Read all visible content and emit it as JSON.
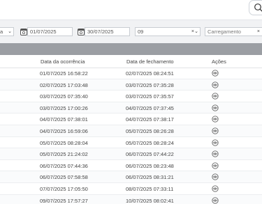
{
  "filters": {
    "status_fragment": "a",
    "date_start": "01/07/2025",
    "date_end": "30/07/2025",
    "code_value": "09",
    "state_placeholder": "Carregamento"
  },
  "table": {
    "headers": {
      "occurrence": "Data da ocorrência",
      "closing": "Data de fechamento",
      "actions": "Ações"
    },
    "rows": [
      {
        "occurrence": "01/07/2025 16:58:22",
        "closing": "02/07/2025 08:24:51"
      },
      {
        "occurrence": "02/07/2025 17:03:48",
        "closing": "03/07/2025 07:35:28"
      },
      {
        "occurrence": "03/07/2025 07:35:40",
        "closing": "03/07/2025 07:35:57"
      },
      {
        "occurrence": "03/07/2025 17:00:26",
        "closing": "04/07/2025 07:37:45"
      },
      {
        "occurrence": "04/07/2025 07:38:01",
        "closing": "04/07/2025 07:38:17"
      },
      {
        "occurrence": "04/07/2025 16:59:06",
        "closing": "05/07/2025 08:26:28"
      },
      {
        "occurrence": "05/07/2025 08:28:04",
        "closing": "05/07/2025 08:28:24"
      },
      {
        "occurrence": "05/07/2025 21:24:02",
        "closing": "06/07/2025 07:44:22"
      },
      {
        "occurrence": "06/07/2025 07:44:36",
        "closing": "06/07/2025 08:23:48"
      },
      {
        "occurrence": "06/07/2025 07:58:58",
        "closing": "06/07/2025 08:31:21"
      },
      {
        "occurrence": "07/07/2025 17:05:50",
        "closing": "08/07/2025 07:33:11"
      },
      {
        "occurrence": "09/07/2025 17:57:27",
        "closing": "10/07/2025 08:02:41"
      }
    ]
  },
  "icons": {
    "search": "search-icon",
    "calendar": "calendar-icon",
    "view": "eye-icon"
  }
}
